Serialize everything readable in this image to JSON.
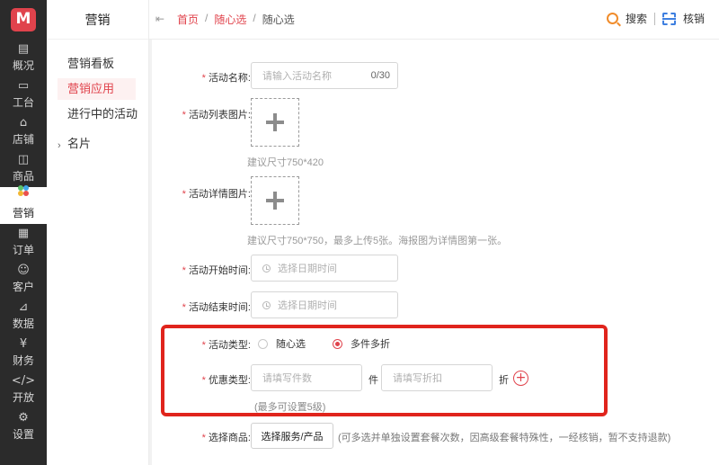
{
  "rail": {
    "items": [
      {
        "label": "概况",
        "icon": "overview-icon"
      },
      {
        "label": "工台",
        "icon": "workbench-icon"
      },
      {
        "label": "店铺",
        "icon": "store-icon"
      },
      {
        "label": "商品",
        "icon": "goods-icon"
      },
      {
        "label": "营销",
        "icon": "marketing-icon"
      },
      {
        "label": "订单",
        "icon": "order-icon"
      },
      {
        "label": "客户",
        "icon": "customer-icon"
      },
      {
        "label": "数据",
        "icon": "data-icon"
      },
      {
        "label": "财务",
        "icon": "finance-icon"
      },
      {
        "label": "开放",
        "icon": "open-icon"
      },
      {
        "label": "设置",
        "icon": "settings-icon"
      }
    ],
    "active_index": 4
  },
  "subnav": {
    "title": "营销",
    "items": [
      "营销看板",
      "营销应用",
      "进行中的活动",
      "名片"
    ],
    "active_index": 1
  },
  "header": {
    "breadcrumb": [
      "首页",
      "随心选",
      "随心选"
    ],
    "search_label": "搜索",
    "verify_label": "核销"
  },
  "form": {
    "name": {
      "label": "活动名称:",
      "placeholder": "请输入活动名称",
      "count": "0/30"
    },
    "list_image": {
      "label": "活动列表图片:",
      "hint": "建议尺寸750*420"
    },
    "detail_image": {
      "label": "活动详情图片:",
      "hint": "建议尺寸750*750，最多上传5张。海报图为详情图第一张。"
    },
    "start_time": {
      "label": "活动开始时间:",
      "placeholder": "选择日期时间"
    },
    "end_time": {
      "label": "活动结束时间:",
      "placeholder": "选择日期时间"
    },
    "type": {
      "label": "活动类型:",
      "options": [
        "随心选",
        "多件多折"
      ],
      "selected_index": 1
    },
    "discount": {
      "label": "优惠类型:",
      "count_placeholder": "请填写件数",
      "count_unit": "件",
      "rate_placeholder": "请填写折扣",
      "rate_unit": "折",
      "add_symbol": "+",
      "note": "(最多可设置5级)"
    },
    "goods": {
      "label": "选择商品:",
      "button": "选择服务/产品",
      "note": "(可多选并单独设置套餐次数，因高级套餐特殊性，一经核销，暂不支持退款)"
    }
  },
  "colors": {
    "accent": "#e0434c",
    "highlight": "#e0241c"
  }
}
